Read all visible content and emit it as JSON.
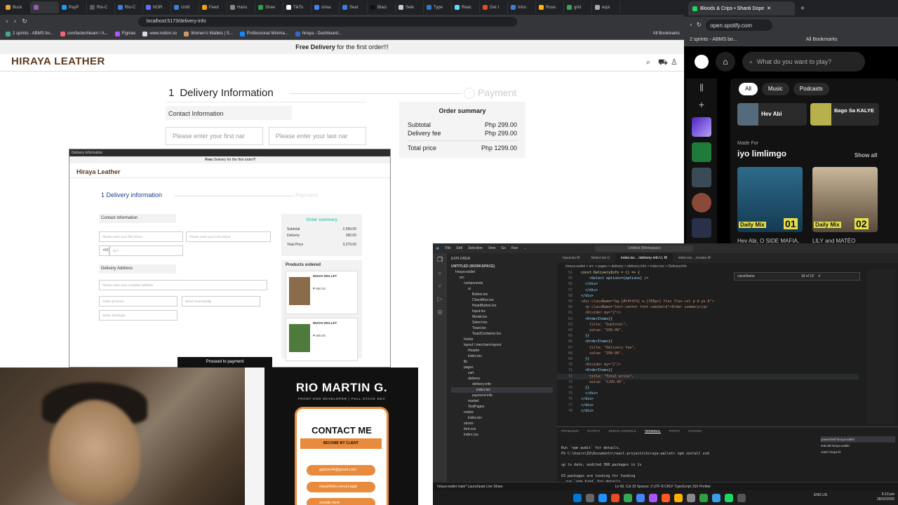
{
  "browser": {
    "tabs": [
      "Buck",
      "",
      "PayP",
      "Rio-C",
      "Rio-C",
      "NOR",
      "Untit",
      "Feed",
      "Hano",
      "Stree",
      "TikTo",
      "strea",
      "Sear",
      "Blaci",
      "Sele",
      "Type",
      "Reac",
      "Get I",
      "Intro",
      "Rose",
      "grid",
      "equi"
    ],
    "url": "localhost:5173/delivery-info",
    "bookmarks": [
      "2 sprints - ABMS bo...",
      "comfactechteam / A...",
      "Figmas",
      "www.notion.so",
      "Women's Wallets | S...",
      "Professional Minima...",
      "hiraya - Dashboard..."
    ],
    "all_bookmarks": "All Bookmarks"
  },
  "site": {
    "promo_bold": "Free Delivery",
    "promo_rest": " for the first order!!!",
    "logo": "HIRAYA LEATHER",
    "step1_num": "1",
    "step1_label": "Delivery Information",
    "step2_num": "2",
    "step2_label": "Payment",
    "contact_label": "Contact Information",
    "first_name_placeholder": "Please enter your first nar",
    "last_name_placeholder": "Please enter your last nar",
    "order": {
      "title": "Order summary",
      "subtotal_label": "Subtotal",
      "subtotal_value": "Php 299.00",
      "delivery_label": "Delivery fee",
      "delivery_value": "Php 299.00",
      "total_label": "Total price",
      "total_value": "Php 1299.00"
    }
  },
  "preview": {
    "window_title": "Delivery information",
    "promo_bold": "Free",
    "promo_rest": " Delivery for the first order!!!",
    "logo": "Hiraya Leather",
    "step1": "1   Delivery information",
    "step2": "Payment",
    "contact": "Contact information",
    "fn": "Please enter your first Name",
    "ln": "Please enter your Last Name",
    "code": "+63",
    "phone": "917...",
    "address": "Delivery Address",
    "full": "Please enter your complete address",
    "province": "Select province",
    "municipality": "Select municipality",
    "barangay": "Select barangay",
    "order_title": "Order summary",
    "rows": [
      [
        "Subtotal",
        "2,599.00"
      ],
      [
        "Delivery",
        "280.00"
      ],
      [
        "Total Price",
        "3,279.00"
      ]
    ],
    "products_title": "Products ordered",
    "product_name": "MUSAI WALLET",
    "product_price": "₱ 690.00",
    "proceed": "Proceed to payment"
  },
  "poster": {
    "name": "RIO MARTIN G.",
    "sub": "FRONT END DEVELOPER | FULL STACK DEV",
    "title": "CONTACT ME",
    "button": "BECOME MY CLIENT",
    "email1": "galsrio44@gmail.com",
    "email2": "riopartfolio.vercel.app/",
    "email3": "socials here"
  },
  "spotify": {
    "tab_title": "Bloods & Crips • Shanti Dope",
    "url": "open.spotify.com",
    "bookmark": "2 sprints - ABMS bo...",
    "all_bookmarks": "All Bookmarks",
    "search_placeholder": "What do you want to play?",
    "chips": [
      "All",
      "Music",
      "Podcasts"
    ],
    "recent1": "Hev Abi",
    "recent2": "Bago Sa KALYE",
    "made_for": "Made For",
    "user": "iyo limlimgo",
    "show_all": "Show all",
    "mix1_label": "Daily Mix",
    "mix1_num": "01",
    "mix2_label": "Daily Mix",
    "mix2_num": "02",
    "caption1": "Hev Abi, O SIDE MAFIA,",
    "caption2": "LILY and MATÉO"
  },
  "vscode": {
    "menu": [
      "File",
      "Edit",
      "Selection",
      "View",
      "Go",
      "Run",
      "..."
    ],
    "command": "Untitled (Workspace)",
    "explorer_title": "EXPLORER",
    "workspace": "UNTITLED (WORKSPACE)",
    "tree": [
      "hiraya-wallet",
      "src",
      "components",
      "ui",
      "Button.tsx",
      "CheckBox.tsx",
      "HeartButton.tsx",
      "Input.tsx",
      "Modal.tsx",
      "Select.tsx",
      "Toast.tsx",
      "ToastContainer.tsx",
      "hooks",
      "layout \\ merchant-layout",
      "Header",
      "index.tsx",
      "lib",
      "pages",
      "cart",
      "delivery",
      "delivery-info",
      "index.tsx",
      "payment-info",
      "market",
      "TestPages",
      "routes",
      "index.tsx",
      "stores",
      "font.css",
      "index.css"
    ],
    "tabs": [
      "Input.tsx M",
      "Select.tsx U",
      "index.tsx ...\\delivery-info U, M",
      "index.tsx ...\\routes M"
    ],
    "breadcrumb": "hiraya-wallet > src > pages > delivery > delivery-info > index.tsx > DeliveryInfo",
    "find_text": "className",
    "find_count": "18 of 19",
    "code_lines": [
      [
        "51",
        "const DeliveryInfo = () => {"
      ],
      [
        "55",
        "    <Select options={options} />"
      ],
      [
        "56",
        "  </div>"
      ],
      [
        "57",
        "  </div>"
      ],
      [
        "58",
        "</div>"
      ],
      [
        "59",
        "<div className=\"bg-[#f4f4f4] w-[350px] flex flex-col p-4 px-6\">"
      ],
      [
        "60",
        "  <p className=\"text-center font-semibold\">Order summary</p>"
      ],
      [
        "61",
        "  <Divider my=\"2\"/>"
      ],
      [
        "62",
        "  <OrderItems{{"
      ],
      [
        "63",
        "    title: \"Subtotal\","
      ],
      [
        "64",
        "    value: \"299.00\","
      ],
      [
        "65",
        "  }}"
      ],
      [
        "66",
        "  <OrderItems{{"
      ],
      [
        "67",
        "    title: \"Delivery fee\","
      ],
      [
        "68",
        "    value: \"299.00\","
      ],
      [
        "69",
        "  }}"
      ],
      [
        "70",
        "  <Divider my=\"2\"/>"
      ],
      [
        "71",
        "  <OrderItems{{"
      ],
      [
        "72",
        "    title: \"Total price\","
      ],
      [
        "73",
        "    value: \"1299.00\","
      ],
      [
        "74",
        "  }}"
      ],
      [
        "75",
        "  </div>"
      ],
      [
        "76",
        "</div>"
      ],
      [
        "77",
        "</div>"
      ],
      [
        "78",
        "</div>"
      ]
    ],
    "panel_tabs": [
      "PROBLEMS",
      "OUTPUT",
      "DEBUG CONSOLE",
      "TERMINAL",
      "PORTS",
      "GITLENS"
    ],
    "terminal": "Run `npm audit` for details.\nPS C:\\Users\\IO\\Documents\\react-projects\\hiraya-wallet> npm install zod\n\nup to date, audited 308 packages in 1s\n\n63 packages are looking for funding\n  run `npm fund` for details",
    "term_list": [
      "powershell hiraya-wallet",
      "esbuild hiraya-wallet",
      "node hiraya-fe"
    ],
    "status_left": "hiraya-wallet  main*  Launchpad  Live Share",
    "status_right": "Ln 69, Col 33  Spaces: 2  UTF-8  CRLF  TypeScript JSX  Prettier",
    "clock_time": "6:13 pm",
    "clock_date": "28/02/2026",
    "lang": "ENG US"
  }
}
